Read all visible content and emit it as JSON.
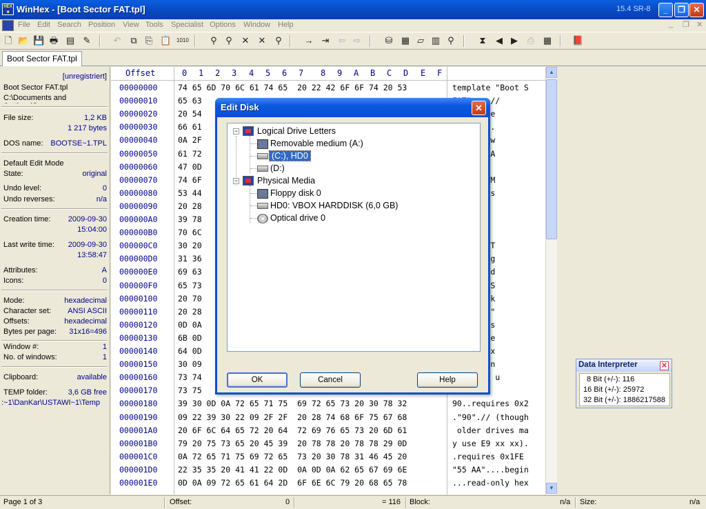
{
  "titlebar": {
    "title": "WinHex - [Boot Sector FAT.tpl]",
    "version": "15.4 SR-8"
  },
  "menu": [
    "File",
    "Edit",
    "Search",
    "Position",
    "View",
    "Tools",
    "Specialist",
    "Options",
    "Window",
    "Help"
  ],
  "tab": {
    "label": "Boot Sector FAT.tpl"
  },
  "info": {
    "registration": "[unregistriert]",
    "filename": "Boot Sector FAT.tpl",
    "path": "C:\\Documents and Settings\\Da",
    "file_size_label": "File size:",
    "file_size": "1,2 KB",
    "file_size_bytes": "1 217 bytes",
    "dos_name_label": "DOS name:",
    "dos_name": "BOOTSE~1.TPL",
    "edit_mode": "Default Edit Mode",
    "state_label": "State:",
    "state": "original",
    "undo_level_label": "Undo level:",
    "undo_level": "0",
    "undo_reverses_label": "Undo reverses:",
    "undo_reverses": "n/a",
    "creation_label": "Creation time:",
    "creation_date": "2009-09-30",
    "creation_time": "15:04:00",
    "lastwrite_label": "Last write time:",
    "lastwrite_date": "2009-09-30",
    "lastwrite_time": "13:58:47",
    "attributes_label": "Attributes:",
    "attributes": "A",
    "icons_label": "Icons:",
    "icons": "0",
    "mode_label": "Mode:",
    "mode": "hexadecimal",
    "charset_label": "Character set:",
    "charset": "ANSI ASCII",
    "offsets_label": "Offsets:",
    "offsets": "hexadecimal",
    "bpp_label": "Bytes per page:",
    "bpp": "31x16=496",
    "window_label": "Window #:",
    "window": "1",
    "nwindows_label": "No. of windows:",
    "nwindows": "1",
    "clipboard_label": "Clipboard:",
    "clipboard": "available",
    "temp_label": "TEMP folder:",
    "temp_free": "3,6 GB free",
    "temp_path": ":~1\\DanKar\\USTAWI~1\\Temp"
  },
  "hex": {
    "header_offset": "Offset",
    "header_cols": [
      "0",
      "1",
      "2",
      "3",
      "4",
      "5",
      "6",
      "7",
      "8",
      "9",
      "A",
      "B",
      "C",
      "D",
      "E",
      "F"
    ],
    "rows": [
      {
        "o": "00000000",
        "h": "74 65 6D 70 6C 61 74 65  20 22 42 6F 6F 74 20 53",
        "a": "template \"Boot S"
      },
      {
        "o": "00000010",
        "h": "65 63",
        "a": "FAT\"....//"
      },
      {
        "o": "00000020",
        "h": "20 54",
        "a": "te by Ste"
      },
      {
        "o": "00000030",
        "h": "66 61",
        "a": "ischmann."
      },
      {
        "o": "00000040",
        "h": "0A 2F",
        "a": "ays Softw"
      },
      {
        "o": "00000050",
        "h": "61 72",
        "a": "hnology A"
      },
      {
        "o": "00000060",
        "h": "47 0D",
        "a": "Boot sec"
      },
      {
        "o": "00000070",
        "h": "74 6F",
        "a": "mat for M"
      },
      {
        "o": "00000080",
        "h": "53 44",
        "a": "0 onwards"
      },
      {
        "o": "00000090",
        "h": "20 28",
        "a": "Windows"
      },
      {
        "o": "000000A0",
        "h": "39 78",
        "a": "To be ap"
      },
      {
        "o": "000000B0",
        "h": "70 6C",
        "a": "o sector"
      },
      {
        "o": "000000C0",
        "h": "30 20",
        "a": "FAT12/FAT"
      },
      {
        "o": "000000D0",
        "h": "31 36",
        "a": "atted log"
      },
      {
        "o": "000000E0",
        "h": "69 63",
        "a": "ive.....d"
      },
      {
        "o": "000000F0",
        "h": "65 73",
        "a": "ion \"BIOS"
      },
      {
        "o": "00000100",
        "h": "20 70",
        "a": "ter block"
      },
      {
        "o": "00000110",
        "h": "20 28",
        "a": "and more\""
      },
      {
        "o": "00000120",
        "h": "0D 0A",
        "a": "es_to dis"
      },
      {
        "o": "00000130",
        "h": "6B 0D",
        "a": "or-aligne"
      },
      {
        "o": "00000140",
        "h": "64 0D",
        "a": "quires 0x"
      },
      {
        "o": "00000150",
        "h": "30 09",
        "a": "// JMP in"
      },
      {
        "o": "00000160",
        "h": "73 74",
        "a": "ion will u"
      },
      {
        "o": "00000170",
        "h": "73 75",
        "a": "be EB xx"
      },
      {
        "o": "00000180",
        "h": "39 30 0D 0A 72 65 71 75  69 72 65 73 20 30 78 32",
        "a": "90..requires 0x2"
      },
      {
        "o": "00000190",
        "h": "09 22 39 30 22 09 2F 2F  20 28 74 68 6F 75 67 68",
        "a": ".\"90\".// (though"
      },
      {
        "o": "000001A0",
        "h": "20 6F 6C 64 65 72 20 64  72 69 76 65 73 20 6D 61",
        "a": " older drives ma"
      },
      {
        "o": "000001B0",
        "h": "79 20 75 73 65 20 45 39  20 78 78 20 78 78 29 0D",
        "a": "y use E9 xx xx)."
      },
      {
        "o": "000001C0",
        "h": "0A 72 65 71 75 69 72 65  73 20 30 78 31 46 45 20",
        "a": ".requires 0x1FE "
      },
      {
        "o": "000001D0",
        "h": "22 35 35 20 41 41 22 0D  0A 0D 0A 62 65 67 69 6E",
        "a": "\"55 AA\"....begin"
      },
      {
        "o": "000001E0",
        "h": "0D 0A 09 72 65 61 64 2D  6F 6E 6C 79 20 68 65 78",
        "a": "...read-only hex"
      }
    ]
  },
  "status": {
    "page": "Page 1 of 3",
    "offset_label": "Offset:",
    "offset_value": "0",
    "eq_value": "= 116",
    "block_label": "Block:",
    "block_value": "n/a",
    "size_label": "Size:",
    "size_value": "n/a"
  },
  "interpreter": {
    "title": "Data Interpreter",
    "lines": [
      "8 Bit (+/-): 116",
      "16 Bit (+/-): 25972",
      "32 Bit (+/-): 1886217588"
    ]
  },
  "dialog": {
    "title": "Edit Disk",
    "tree": {
      "logical": "Logical Drive Letters",
      "removable": "Removable medium (A:)",
      "c_drive": "(C:), HD0",
      "d_drive": "(D:)",
      "physical": "Physical Media",
      "floppy": "Floppy disk 0",
      "hd0": "HD0: VBOX HARDDISK (6,0 GB)",
      "optical": "Optical drive 0"
    },
    "ok": "OK",
    "cancel": "Cancel",
    "help": "Help"
  },
  "icons": {
    "app": "winhex-app-icon",
    "minimize": "minimize-icon",
    "restore": "restore-icon",
    "close": "close-icon"
  },
  "colors": {
    "titlebar": "#0a4fd4",
    "offset_text": "#00008b",
    "selection": "#316ac5"
  }
}
